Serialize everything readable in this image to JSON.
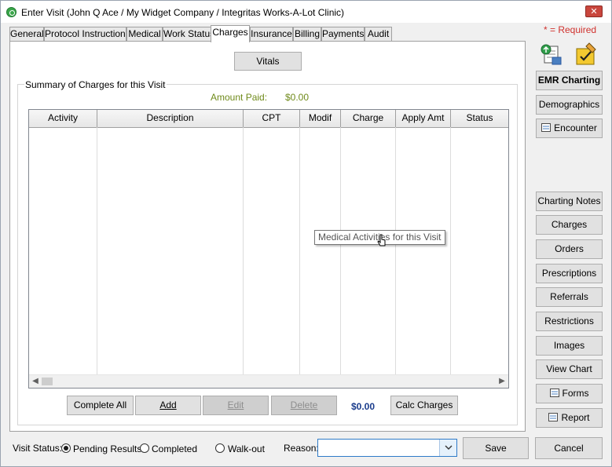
{
  "window": {
    "title": "Enter Visit (John Q Ace / My Widget Company / Integritas Works-A-Lot Clinic)",
    "close_label": "✕"
  },
  "tabs": [
    {
      "label": "General"
    },
    {
      "label": "Protocol Instructions"
    },
    {
      "label": "Medical"
    },
    {
      "label": "Work Status"
    },
    {
      "label": "Charges",
      "active": true
    },
    {
      "label": "Insurance"
    },
    {
      "label": "Billing"
    },
    {
      "label": "Payments"
    },
    {
      "label": "Audit"
    }
  ],
  "required_note": "* = Required",
  "vitals_label": "Vitals",
  "summary": {
    "group_label": "Summary of Charges for this Visit",
    "amount_paid_label": "Amount Paid:",
    "amount_paid_value": "$0.00"
  },
  "grid": {
    "columns": [
      "Activity",
      "Description",
      "CPT",
      "Modif",
      "Charge",
      "Apply Amt",
      "Status"
    ],
    "rows": []
  },
  "tooltip": "Medical Activities for this Visit",
  "actions": {
    "complete_all": "Complete All",
    "add": "Add",
    "edit": "Edit",
    "delete": "Delete",
    "total": "$0.00",
    "calc_charges": "Calc Charges"
  },
  "visit_status": {
    "label": "Visit Status:",
    "options": [
      {
        "label": "Pending Results",
        "checked": true
      },
      {
        "label": "Completed",
        "checked": false
      },
      {
        "label": "Walk-out",
        "checked": false
      }
    ]
  },
  "reason": {
    "label": "Reason:",
    "value": ""
  },
  "footer": {
    "save": "Save",
    "cancel": "Cancel"
  },
  "sidebar": {
    "emr_charting": "EMR Charting",
    "demographics": "Demographics",
    "encounter": "Encounter",
    "charting_notes": "Charting Notes",
    "charges": "Charges",
    "orders": "Orders",
    "prescriptions": "Prescriptions",
    "referrals": "Referrals",
    "restrictions": "Restrictions",
    "images": "Images",
    "view_chart": "View Chart",
    "forms": "Forms",
    "report": "Report"
  },
  "colors": {
    "accent_green": "#6f8a1a",
    "required_red": "#d0312d",
    "total_blue": "#1a3c8c"
  }
}
